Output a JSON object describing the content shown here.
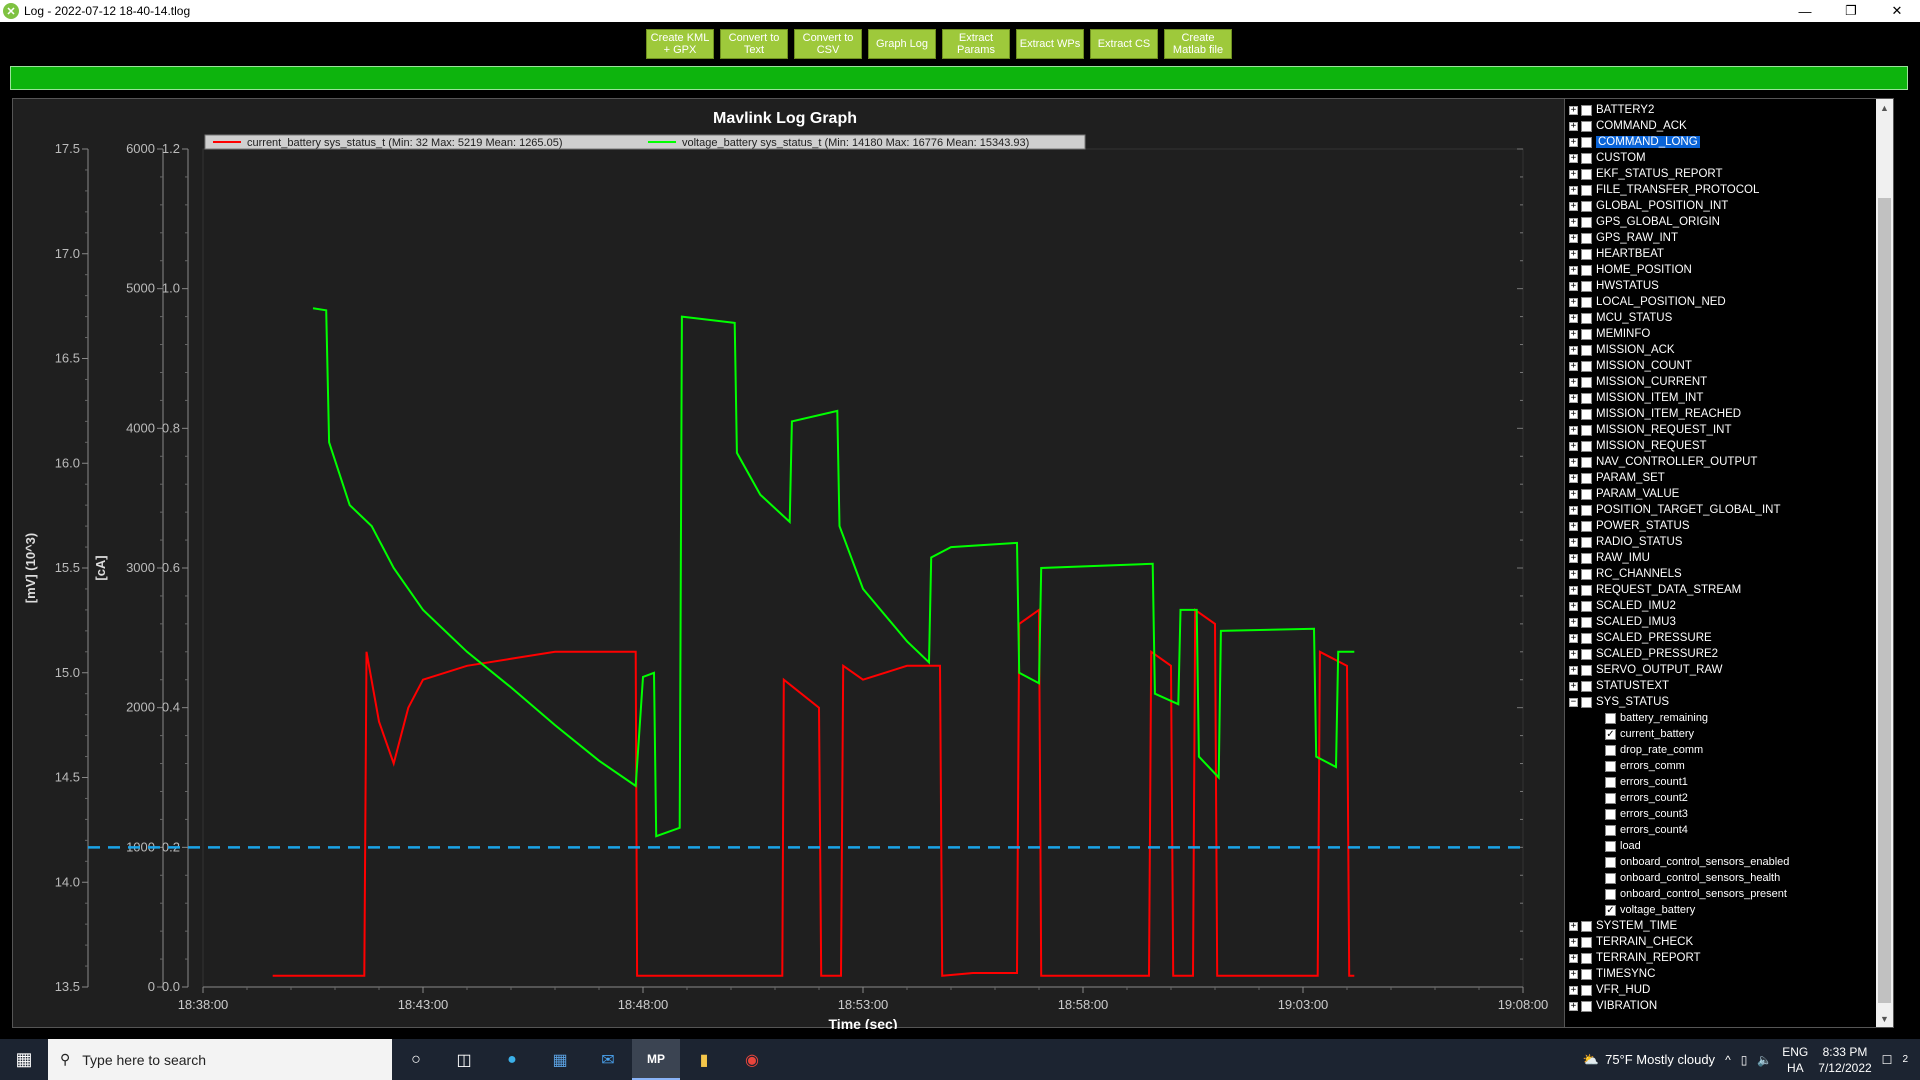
{
  "window": {
    "title": "Log - 2022-07-12 18-40-14.tlog",
    "icon": "mission-planner-icon",
    "controls": [
      "minimize",
      "restore",
      "close"
    ]
  },
  "toolbar": {
    "buttons": [
      {
        "label": "Create KML\n+ GPX"
      },
      {
        "label": "Convert to\nText"
      },
      {
        "label": "Convert to\nCSV"
      },
      {
        "label": "Graph Log"
      },
      {
        "label": "Extract\nParams"
      },
      {
        "label": "Extract WPs"
      },
      {
        "label": "Extract CS"
      },
      {
        "label": "Create\nMatlab file"
      }
    ]
  },
  "progress": {
    "value": 1.0,
    "color": "#0db40d"
  },
  "graph": {
    "title": "Mavlink Log Graph",
    "xlabel": "Time (sec)",
    "ylabel_mv": "[mV] (10^3)",
    "ylabel_ca": "[cA]",
    "background": "#1f1f1f",
    "legend": [
      {
        "text": "current_battery sys_status_t (Min: 32 Max: 5219 Mean: 1265.05)",
        "color": "#ff0000"
      },
      {
        "text": "voltage_battery sys_status_t (Min: 14180 Max: 16776 Mean: 15343.93)",
        "color": "#00ff00"
      }
    ]
  },
  "chart_data": {
    "type": "line",
    "title": "Mavlink Log Graph",
    "xlabel": "Time (sec)",
    "x_ticks": [
      "18:38:00",
      "18:43:00",
      "18:48:00",
      "18:53:00",
      "18:58:00",
      "19:03:00",
      "19:08:00"
    ],
    "xlim": [
      "18:38:00",
      "19:08:00"
    ],
    "axes": [
      {
        "label": "[mV] (10^3)",
        "ticks": [
          "13.5",
          "14.0",
          "14.5",
          "15.0",
          "15.5",
          "16.0",
          "16.5",
          "17.0",
          "17.5"
        ],
        "ylim": [
          13.5,
          17.5
        ]
      },
      {
        "label": "[cA]",
        "ticks": [
          "0",
          "1000",
          "2000",
          "3000",
          "4000",
          "5000",
          "6000"
        ],
        "ylim": [
          0,
          6000
        ]
      },
      {
        "label": "",
        "ticks": [
          "0.0",
          "0.2",
          "0.4",
          "0.6",
          "0.8",
          "1.0",
          "1.2"
        ],
        "ylim": [
          0.0,
          1.2
        ]
      }
    ],
    "reference_line": {
      "y": 1000,
      "axis": "[cA]",
      "color": "#1aa3e8",
      "style": "dashed"
    },
    "series": [
      {
        "name": "current_battery sys_status_t",
        "axis": "[cA]",
        "color": "#ff0000",
        "points": [
          [
            "18:39:35",
            80
          ],
          [
            "18:41:40",
            80
          ],
          [
            "18:41:43",
            2400
          ],
          [
            "18:42:00",
            1900
          ],
          [
            "18:42:20",
            1600
          ],
          [
            "18:42:40",
            2000
          ],
          [
            "18:43:00",
            2200
          ],
          [
            "18:44:00",
            2300
          ],
          [
            "18:45:00",
            2350
          ],
          [
            "18:46:00",
            2400
          ],
          [
            "18:47:50",
            2400
          ],
          [
            "18:47:52",
            80
          ],
          [
            "18:49:00",
            80
          ],
          [
            "18:51:10",
            80
          ],
          [
            "18:51:12",
            2200
          ],
          [
            "18:52:00",
            2000
          ],
          [
            "18:52:03",
            80
          ],
          [
            "18:52:30",
            80
          ],
          [
            "18:52:33",
            2300
          ],
          [
            "18:53:00",
            2200
          ],
          [
            "18:54:00",
            2300
          ],
          [
            "18:54:45",
            2300
          ],
          [
            "18:54:48",
            80
          ],
          [
            "18:55:30",
            100
          ],
          [
            "18:56:30",
            100
          ],
          [
            "18:56:33",
            2600
          ],
          [
            "18:57:00",
            2700
          ],
          [
            "18:57:03",
            80
          ],
          [
            "18:59:30",
            80
          ],
          [
            "18:59:33",
            2400
          ],
          [
            "19:00:00",
            2300
          ],
          [
            "19:00:03",
            80
          ],
          [
            "19:00:30",
            80
          ],
          [
            "19:00:33",
            2700
          ],
          [
            "19:01:00",
            2600
          ],
          [
            "19:01:03",
            80
          ],
          [
            "19:03:20",
            80
          ],
          [
            "19:03:23",
            2400
          ],
          [
            "19:04:00",
            2300
          ],
          [
            "19:04:03",
            80
          ],
          [
            "19:04:10",
            80
          ]
        ]
      },
      {
        "name": "voltage_battery sys_status_t",
        "axis": "[mV] (10^3)",
        "color": "#00ff00",
        "points": [
          [
            "18:40:30",
            16.74
          ],
          [
            "18:40:48",
            16.73
          ],
          [
            "18:40:52",
            16.1
          ],
          [
            "18:41:20",
            15.8
          ],
          [
            "18:41:50",
            15.7
          ],
          [
            "18:42:20",
            15.5
          ],
          [
            "18:43:00",
            15.3
          ],
          [
            "18:44:00",
            15.1
          ],
          [
            "18:45:00",
            14.93
          ],
          [
            "18:46:00",
            14.75
          ],
          [
            "18:47:00",
            14.58
          ],
          [
            "18:47:50",
            14.46
          ],
          [
            "18:48:00",
            14.98
          ],
          [
            "18:48:15",
            15.0
          ],
          [
            "18:48:18",
            14.22
          ],
          [
            "18:48:50",
            14.26
          ],
          [
            "18:48:53",
            16.7
          ],
          [
            "18:50:05",
            16.67
          ],
          [
            "18:50:08",
            16.05
          ],
          [
            "18:50:40",
            15.85
          ],
          [
            "18:51:20",
            15.72
          ],
          [
            "18:51:23",
            16.2
          ],
          [
            "18:52:25",
            16.25
          ],
          [
            "18:52:28",
            15.7
          ],
          [
            "18:53:00",
            15.4
          ],
          [
            "18:54:00",
            15.15
          ],
          [
            "18:54:30",
            15.05
          ],
          [
            "18:54:33",
            15.55
          ],
          [
            "18:55:00",
            15.6
          ],
          [
            "18:56:30",
            15.62
          ],
          [
            "18:56:33",
            15.0
          ],
          [
            "18:57:00",
            14.95
          ],
          [
            "18:57:03",
            15.5
          ],
          [
            "18:59:35",
            15.52
          ],
          [
            "18:59:38",
            14.9
          ],
          [
            "19:00:10",
            14.85
          ],
          [
            "19:00:13",
            15.3
          ],
          [
            "19:00:35",
            15.3
          ],
          [
            "19:00:38",
            14.6
          ],
          [
            "19:01:05",
            14.5
          ],
          [
            "19:01:08",
            15.2
          ],
          [
            "19:03:15",
            15.21
          ],
          [
            "19:03:18",
            14.6
          ],
          [
            "19:03:45",
            14.55
          ],
          [
            "19:03:48",
            15.1
          ],
          [
            "19:04:10",
            15.1
          ]
        ]
      }
    ]
  },
  "tree": {
    "items_before": [
      "BATTERY2",
      "COMMAND_ACK",
      "COMMAND_LONG",
      "CUSTOM",
      "EKF_STATUS_REPORT",
      "FILE_TRANSFER_PROTOCOL",
      "GLOBAL_POSITION_INT",
      "GPS_GLOBAL_ORIGIN",
      "GPS_RAW_INT",
      "HEARTBEAT",
      "HOME_POSITION",
      "HWSTATUS",
      "LOCAL_POSITION_NED",
      "MCU_STATUS",
      "MEMINFO",
      "MISSION_ACK",
      "MISSION_COUNT",
      "MISSION_CURRENT",
      "MISSION_ITEM_INT",
      "MISSION_ITEM_REACHED",
      "MISSION_REQUEST_INT",
      "MISSION_REQUEST",
      "NAV_CONTROLLER_OUTPUT",
      "PARAM_SET",
      "PARAM_VALUE",
      "POSITION_TARGET_GLOBAL_INT",
      "POWER_STATUS",
      "RADIO_STATUS",
      "RAW_IMU",
      "RC_CHANNELS",
      "REQUEST_DATA_STREAM",
      "SCALED_IMU2",
      "SCALED_IMU3",
      "SCALED_PRESSURE",
      "SCALED_PRESSURE2",
      "SERVO_OUTPUT_RAW",
      "STATUSTEXT"
    ],
    "selected": "COMMAND_LONG",
    "expanded": "SYS_STATUS",
    "children": [
      {
        "label": "battery_remaining",
        "checked": false
      },
      {
        "label": "current_battery",
        "checked": true
      },
      {
        "label": "drop_rate_comm",
        "checked": false
      },
      {
        "label": "errors_comm",
        "checked": false
      },
      {
        "label": "errors_count1",
        "checked": false
      },
      {
        "label": "errors_count2",
        "checked": false
      },
      {
        "label": "errors_count3",
        "checked": false
      },
      {
        "label": "errors_count4",
        "checked": false
      },
      {
        "label": "load",
        "checked": false
      },
      {
        "label": "onboard_control_sensors_enabled",
        "checked": false
      },
      {
        "label": "onboard_control_sensors_health",
        "checked": false
      },
      {
        "label": "onboard_control_sensors_present",
        "checked": false
      },
      {
        "label": "voltage_battery",
        "checked": true
      }
    ],
    "items_after": [
      "SYSTEM_TIME",
      "TERRAIN_CHECK",
      "TERRAIN_REPORT",
      "TIMESYNC",
      "VFR_HUD",
      "VIBRATION"
    ]
  },
  "taskbar": {
    "search_placeholder": "Type here to search",
    "weather": "75°F  Mostly cloudy",
    "lang_top": "ENG",
    "lang_bottom": "HA",
    "time": "8:33 PM",
    "date": "7/12/2022",
    "notification_count": "2"
  }
}
